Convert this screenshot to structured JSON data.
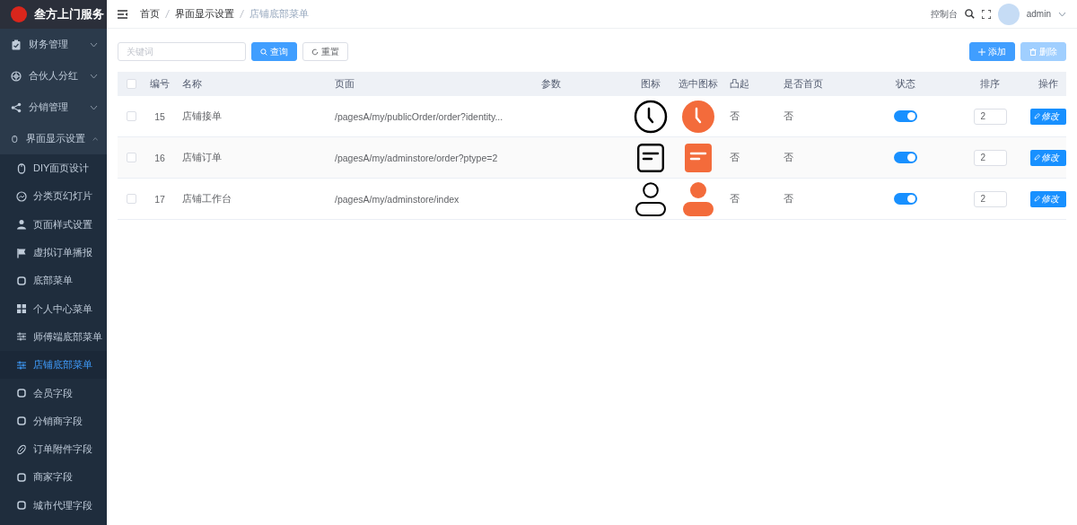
{
  "app": {
    "title": "叁方上门服务"
  },
  "sidebar": {
    "items": [
      {
        "label": "财务管理",
        "expanded": false
      },
      {
        "label": "合伙人分红",
        "expanded": false
      },
      {
        "label": "分销管理",
        "expanded": false
      },
      {
        "label": "界面显示设置",
        "expanded": true,
        "children": [
          {
            "label": "DIY面页设计",
            "selected": false
          },
          {
            "label": "分类页幻灯片",
            "selected": false
          },
          {
            "label": "页面样式设置",
            "selected": false
          },
          {
            "label": "虚拟订单播报",
            "selected": false
          },
          {
            "label": "底部菜单",
            "selected": false
          },
          {
            "label": "个人中心菜单",
            "selected": false
          },
          {
            "label": "师傅端底部菜单",
            "selected": false
          },
          {
            "label": "店铺底部菜单",
            "selected": true
          },
          {
            "label": "会员字段",
            "selected": false
          },
          {
            "label": "分销商字段",
            "selected": false
          },
          {
            "label": "订单附件字段",
            "selected": false
          },
          {
            "label": "商家字段",
            "selected": false
          },
          {
            "label": "城市代理字段",
            "selected": false
          }
        ]
      }
    ]
  },
  "header": {
    "breadcrumb": [
      "首页",
      "界面显示设置",
      "店铺底部菜单"
    ],
    "console": "控制台",
    "user": "admin"
  },
  "toolbar": {
    "search": {
      "placeholder": "关键词"
    },
    "query": "查询",
    "reset": "重置",
    "add": "添加",
    "delete": {
      "label": "删除",
      "disabled": true
    }
  },
  "table": {
    "select_all": {
      "checked": false
    },
    "columns": [
      "编号",
      "名称",
      "页面",
      "参数",
      "图标",
      "选中图标",
      "凸起",
      "是否首页",
      "状态",
      "排序",
      "操作"
    ],
    "rows": [
      {
        "checked": false,
        "id": "15",
        "name": "店铺接单",
        "page": "/pagesA/my/publicOrder/order?identity...",
        "raised": "否",
        "home": "否",
        "on": true,
        "sort": "2",
        "action": "修改"
      },
      {
        "checked": false,
        "id": "16",
        "name": "店铺订单",
        "page": "/pagesA/my/adminstore/order?ptype=2",
        "raised": "否",
        "home": "否",
        "on": true,
        "sort": "2",
        "action": "修改"
      },
      {
        "checked": false,
        "id": "17",
        "name": "店铺工作台",
        "page": "/pagesA/my/adminstore/index",
        "raised": "否",
        "home": "否",
        "on": true,
        "sort": "2",
        "action": "修改"
      }
    ]
  }
}
